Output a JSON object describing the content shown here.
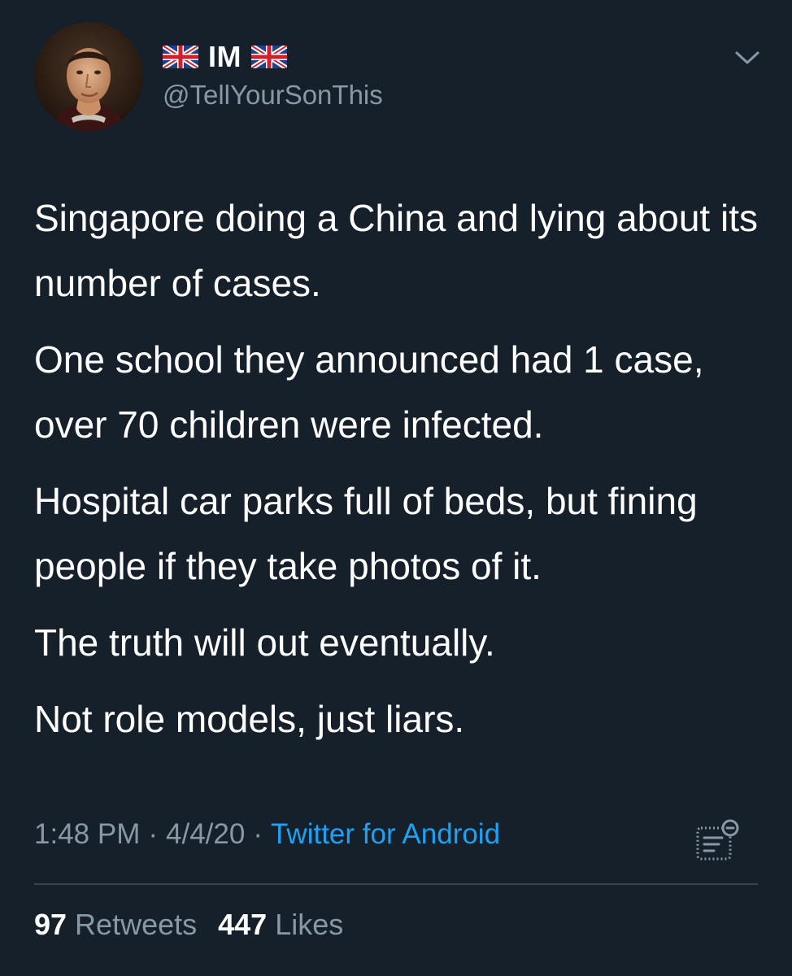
{
  "author": {
    "display_name": "IM",
    "handle": "@TellYourSonThis",
    "flag_icon": "uk-flag-icon"
  },
  "tweet": {
    "paragraphs": [
      "Singapore doing a China and lying about its number of cases.",
      "One school they announced had 1 case, over 70 children were infected.",
      "Hospital car parks full of beds, but fining people if they take photos of it.",
      "The truth will out eventually.",
      "Not role models, just liars."
    ],
    "time": "1:48 PM",
    "date": "4/4/20",
    "source": "Twitter for Android",
    "separator": "·"
  },
  "stats": {
    "retweets_count": "97",
    "retweets_label": "Retweets",
    "likes_count": "447",
    "likes_label": "Likes"
  },
  "colors": {
    "background": "#15202b",
    "text": "#ffffff",
    "secondary": "#8899a6",
    "link": "#1da1f2",
    "divider": "#38444d"
  }
}
